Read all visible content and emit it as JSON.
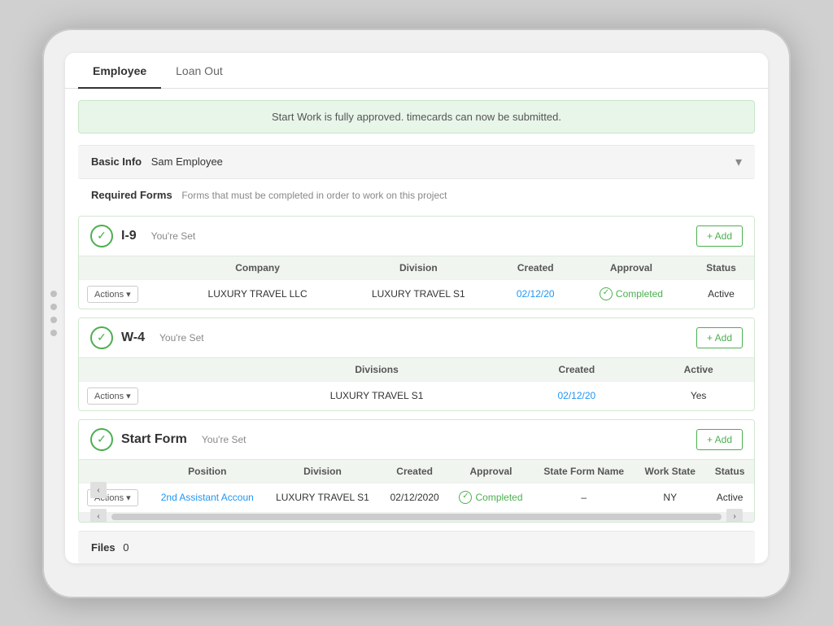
{
  "tabs": [
    {
      "id": "employee",
      "label": "Employee",
      "active": true
    },
    {
      "id": "loan-out",
      "label": "Loan Out",
      "active": false
    }
  ],
  "banner": {
    "text": "Start Work is fully approved. timecards can now be submitted."
  },
  "basic_info": {
    "label": "Basic Info",
    "name": "Sam Employee",
    "chevron": "▾"
  },
  "required_forms": {
    "title": "Required Forms",
    "subtitle": "Forms that must be completed in order to work on this project"
  },
  "forms": [
    {
      "id": "i9",
      "name": "I-9",
      "status_text": "You're Set",
      "add_label": "+ Add",
      "columns": [
        "Company",
        "Division",
        "Created",
        "Approval",
        "Status"
      ],
      "rows": [
        {
          "actions": "Actions",
          "company": "LUXURY TRAVEL LLC",
          "division": "LUXURY TRAVEL S1",
          "created": "02/12/20",
          "approval": "Completed",
          "status": "Active"
        }
      ]
    },
    {
      "id": "w4",
      "name": "W-4",
      "status_text": "You're Set",
      "add_label": "+ Add",
      "columns": [
        "Divisions",
        "Created",
        "Active"
      ],
      "rows": [
        {
          "actions": "Actions",
          "division": "LUXURY TRAVEL S1",
          "created": "02/12/20",
          "active": "Yes"
        }
      ]
    },
    {
      "id": "start-form",
      "name": "Start Form",
      "status_text": "You're Set",
      "add_label": "+ Add",
      "columns": [
        "Position",
        "Division",
        "Created",
        "Approval",
        "State Form Name",
        "Work State",
        "Status"
      ],
      "rows": [
        {
          "actions": "Actions",
          "position": "2nd Assistant Accoun",
          "division": "LUXURY TRAVEL S1",
          "created": "02/12/2020",
          "approval": "Completed",
          "state_form_name": "–",
          "work_state": "NY",
          "status": "Active"
        }
      ]
    }
  ],
  "files": {
    "label": "Files",
    "count": "0"
  }
}
